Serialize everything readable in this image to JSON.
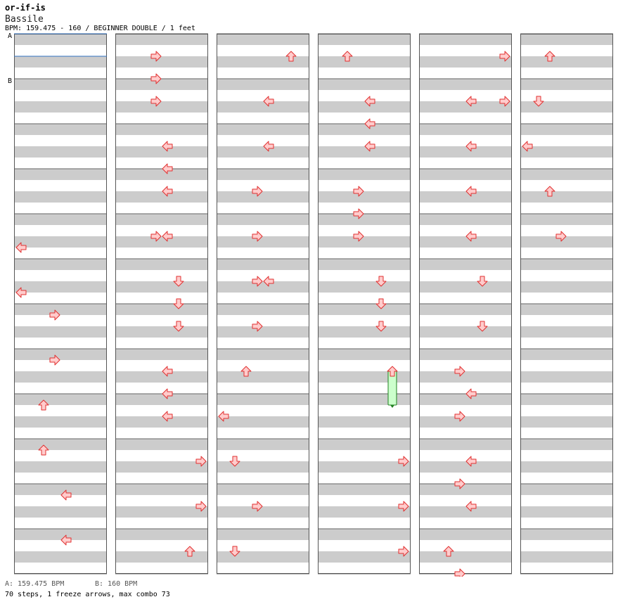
{
  "header": {
    "title": "or-if-is",
    "artist": "Bassile",
    "bpm_line": "BPM: 159.475 - 160 / BEGINNER DOUBLE / 1 feet"
  },
  "bpm_markers": [
    {
      "label": "A",
      "beat": 0
    },
    {
      "label": "B",
      "beat": 4
    }
  ],
  "legend": {
    "a": "A: 159.475 BPM",
    "b": "B: 160 BPM"
  },
  "summary": "70 steps, 1 freeze arrows, max combo 73",
  "colors": {
    "stripe": "#cccccc",
    "border": "#555555",
    "arrow_fill": "#ffcccc",
    "arrow_stroke": "#e03030",
    "freeze_fill": "#ccffcc",
    "freeze_stroke": "#208020",
    "bpm_line": "#3070c0"
  },
  "chart_layout": {
    "columns": 6,
    "measures_per_column": 12,
    "lanes": [
      "left-1",
      "down-1",
      "up-1",
      "right-1",
      "left-2",
      "down-2",
      "up-2",
      "right-2"
    ]
  },
  "notes": [
    {
      "col": 0,
      "beat": 38,
      "lane": 0
    },
    {
      "col": 0,
      "beat": 46,
      "lane": 0
    },
    {
      "col": 0,
      "beat": 50,
      "lane": 3
    },
    {
      "col": 0,
      "beat": 58,
      "lane": 3
    },
    {
      "col": 0,
      "beat": 66,
      "lane": 2
    },
    {
      "col": 0,
      "beat": 74,
      "lane": 2
    },
    {
      "col": 0,
      "beat": 82,
      "lane": 4
    },
    {
      "col": 0,
      "beat": 90,
      "lane": 4
    },
    {
      "col": 1,
      "beat": 4,
      "lane": 3
    },
    {
      "col": 1,
      "beat": 8,
      "lane": 3
    },
    {
      "col": 1,
      "beat": 12,
      "lane": 3
    },
    {
      "col": 1,
      "beat": 20,
      "lane": 4
    },
    {
      "col": 1,
      "beat": 24,
      "lane": 4
    },
    {
      "col": 1,
      "beat": 28,
      "lane": 4
    },
    {
      "col": 1,
      "beat": 36,
      "lane": 3
    },
    {
      "col": 1,
      "beat": 36,
      "lane": 4
    },
    {
      "col": 1,
      "beat": 44,
      "lane": 5
    },
    {
      "col": 1,
      "beat": 48,
      "lane": 5
    },
    {
      "col": 1,
      "beat": 52,
      "lane": 5
    },
    {
      "col": 1,
      "beat": 60,
      "lane": 4
    },
    {
      "col": 1,
      "beat": 64,
      "lane": 4
    },
    {
      "col": 1,
      "beat": 68,
      "lane": 4
    },
    {
      "col": 1,
      "beat": 76,
      "lane": 7
    },
    {
      "col": 1,
      "beat": 84,
      "lane": 7
    },
    {
      "col": 1,
      "beat": 92,
      "lane": 6
    },
    {
      "col": 2,
      "beat": 4,
      "lane": 6
    },
    {
      "col": 2,
      "beat": 12,
      "lane": 4
    },
    {
      "col": 2,
      "beat": 20,
      "lane": 4
    },
    {
      "col": 2,
      "beat": 28,
      "lane": 3
    },
    {
      "col": 2,
      "beat": 36,
      "lane": 3
    },
    {
      "col": 2,
      "beat": 44,
      "lane": 3
    },
    {
      "col": 2,
      "beat": 44,
      "lane": 4
    },
    {
      "col": 2,
      "beat": 52,
      "lane": 3
    },
    {
      "col": 2,
      "beat": 60,
      "lane": 2
    },
    {
      "col": 2,
      "beat": 68,
      "lane": 0
    },
    {
      "col": 2,
      "beat": 76,
      "lane": 1
    },
    {
      "col": 2,
      "beat": 84,
      "lane": 3
    },
    {
      "col": 2,
      "beat": 92,
      "lane": 1
    },
    {
      "col": 3,
      "beat": 4,
      "lane": 2
    },
    {
      "col": 3,
      "beat": 12,
      "lane": 4
    },
    {
      "col": 3,
      "beat": 16,
      "lane": 4
    },
    {
      "col": 3,
      "beat": 20,
      "lane": 4
    },
    {
      "col": 3,
      "beat": 28,
      "lane": 3
    },
    {
      "col": 3,
      "beat": 32,
      "lane": 3
    },
    {
      "col": 3,
      "beat": 36,
      "lane": 3
    },
    {
      "col": 3,
      "beat": 44,
      "lane": 5
    },
    {
      "col": 3,
      "beat": 48,
      "lane": 5
    },
    {
      "col": 3,
      "beat": 52,
      "lane": 5
    },
    {
      "col": 3,
      "beat": 60,
      "lane": 6,
      "freeze_beats": 6
    },
    {
      "col": 3,
      "beat": 76,
      "lane": 7
    },
    {
      "col": 3,
      "beat": 84,
      "lane": 7
    },
    {
      "col": 3,
      "beat": 92,
      "lane": 7
    },
    {
      "col": 4,
      "beat": 4,
      "lane": 7
    },
    {
      "col": 4,
      "beat": 12,
      "lane": 4
    },
    {
      "col": 4,
      "beat": 12,
      "lane": 7
    },
    {
      "col": 4,
      "beat": 20,
      "lane": 4
    },
    {
      "col": 4,
      "beat": 28,
      "lane": 4
    },
    {
      "col": 4,
      "beat": 36,
      "lane": 4
    },
    {
      "col": 4,
      "beat": 44,
      "lane": 5
    },
    {
      "col": 4,
      "beat": 52,
      "lane": 5
    },
    {
      "col": 4,
      "beat": 60,
      "lane": 3
    },
    {
      "col": 4,
      "beat": 64,
      "lane": 4
    },
    {
      "col": 4,
      "beat": 68,
      "lane": 3
    },
    {
      "col": 4,
      "beat": 76,
      "lane": 4
    },
    {
      "col": 4,
      "beat": 80,
      "lane": 3
    },
    {
      "col": 4,
      "beat": 84,
      "lane": 4
    },
    {
      "col": 4,
      "beat": 92,
      "lane": 2
    },
    {
      "col": 4,
      "beat": 96,
      "lane": 3
    },
    {
      "col": 5,
      "beat": 4,
      "lane": 2
    },
    {
      "col": 5,
      "beat": 12,
      "lane": 1
    },
    {
      "col": 5,
      "beat": 20,
      "lane": 0
    },
    {
      "col": 5,
      "beat": 28,
      "lane": 2
    },
    {
      "col": 5,
      "beat": 36,
      "lane": 3
    }
  ]
}
